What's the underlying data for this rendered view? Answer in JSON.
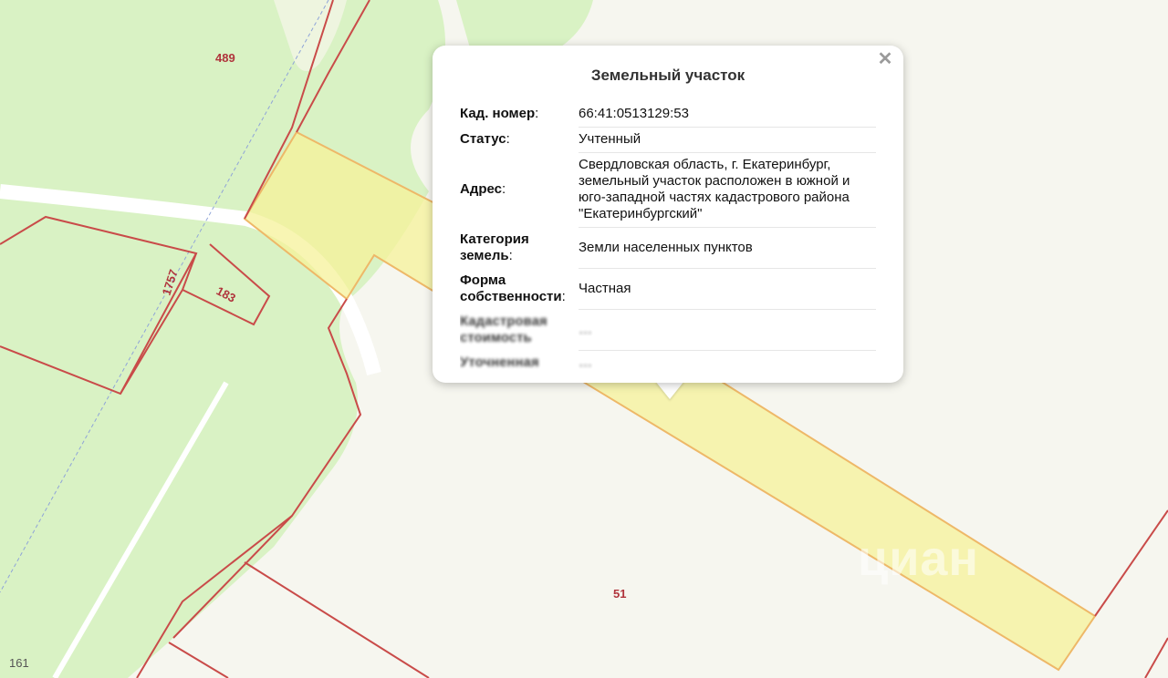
{
  "map": {
    "plot_numbers": [
      "489",
      "1757",
      "183",
      "51"
    ],
    "corner_label": "161",
    "watermark": "циан",
    "colors": {
      "forest": "#d9f2c4",
      "background": "#f6f6ef",
      "boundary": "#c94b49",
      "selected_plot": "#f6f29a"
    }
  },
  "popup": {
    "title": "Земельный участок",
    "close_icon": "close-icon",
    "rows": [
      {
        "label": "Кад. номер",
        "value": "66:41:0513129:53"
      },
      {
        "label": "Статус",
        "value": "Учтенный"
      },
      {
        "label": "Адрес",
        "value": "Свердловская область, г. Екатеринбург, земельный участок расположен в южной и юго-западной частях кадастрового района \"Екатеринбургский\""
      },
      {
        "label": "Категория земель",
        "value": "Земли населенных пунктов"
      },
      {
        "label": "Форма собственности",
        "value": "Частная"
      },
      {
        "label": "Кадастровая стоимость",
        "value": "…"
      },
      {
        "label": "Уточненная",
        "value": "…"
      }
    ]
  }
}
